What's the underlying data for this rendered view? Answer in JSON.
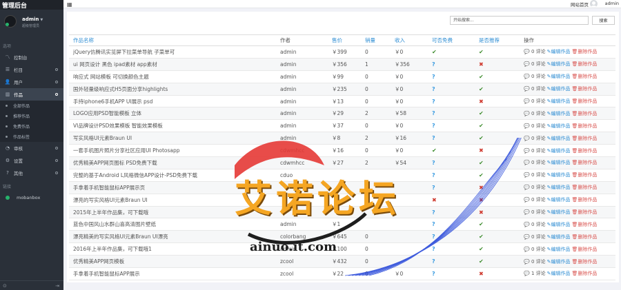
{
  "app": {
    "title": "管理后台"
  },
  "user": {
    "name": "admin",
    "role": "超级管理员"
  },
  "sidebar": {
    "section_title": "选项",
    "items": [
      {
        "label": "控制台",
        "icon": "chart-line-icon"
      },
      {
        "label": "栏目",
        "icon": "list-icon"
      },
      {
        "label": "用户",
        "icon": "user-icon"
      },
      {
        "label": "作品",
        "icon": "book-icon"
      }
    ],
    "sub_items": [
      "全部作品",
      "推荐作品",
      "免费作品",
      "作品标签"
    ],
    "items_after": [
      {
        "label": "审核",
        "icon": "circle-icon"
      },
      {
        "label": "设置",
        "icon": "gear-icon"
      },
      {
        "label": "其他",
        "icon": "help-icon"
      }
    ],
    "links_title": "链接",
    "links": [
      "mobanbox"
    ]
  },
  "topbar": {
    "site_link": "网站首页",
    "username": "admin"
  },
  "search": {
    "placeholder": "开始搜索...",
    "button_label": "搜索"
  },
  "table": {
    "headers": [
      "作品名称",
      "作者",
      "售价",
      "销量",
      "收入",
      "可否免费",
      "是否推荐",
      "操作"
    ],
    "op_labels": {
      "comment_suffix": "评论",
      "edit": "编辑作品",
      "delete": "删除作品"
    },
    "rows": [
      {
        "name": "jQuery仿腾讯实览屏下拉菜单导航 子菜单可",
        "author": "admin",
        "price": "￥399",
        "sales": "0",
        "income": "￥0",
        "free": "yes",
        "recommend": "yes",
        "comments": "0"
      },
      {
        "name": "ui 网页设计 黑色 ipad素材 app素材",
        "author": "admin",
        "price": "￥356",
        "sales": "1",
        "income": "￥356",
        "free": "q",
        "recommend": "no",
        "comments": "0"
      },
      {
        "name": "响应式 网站模板 可切换颜色主题",
        "author": "admin",
        "price": "￥99",
        "sales": "0",
        "income": "￥0",
        "free": "q",
        "recommend": "yes",
        "comments": "0"
      },
      {
        "name": "国外轻量级响应式H5页面分享highlights",
        "author": "admin",
        "price": "￥235",
        "sales": "0",
        "income": "￥0",
        "free": "q",
        "recommend": "yes",
        "comments": "0"
      },
      {
        "name": "手持iphone6手机APP UI展示 psd",
        "author": "admin",
        "price": "￥13",
        "sales": "0",
        "income": "￥0",
        "free": "q",
        "recommend": "no",
        "comments": "0"
      },
      {
        "name": "LOGO应用PSD智能模板 立体",
        "author": "admin",
        "price": "￥29",
        "sales": "2",
        "income": "￥58",
        "free": "q",
        "recommend": "yes",
        "comments": "0"
      },
      {
        "name": "VI品牌设计PSD效果模板 智能效果模板",
        "author": "admin",
        "price": "￥37",
        "sales": "0",
        "income": "￥0",
        "free": "q",
        "recommend": "yes",
        "comments": "0"
      },
      {
        "name": "写实风格UI元素Braun UI",
        "author": "admin",
        "price": "￥8",
        "sales": "2",
        "income": "￥16",
        "free": "q",
        "recommend": "yes",
        "comments": "0"
      },
      {
        "name": "一套手机图片照片分享社区应用UI Photosapp",
        "author": "cdwmhcc",
        "price": "￥16",
        "sales": "0",
        "income": "￥0",
        "free": "yes",
        "recommend": "no",
        "comments": "0"
      },
      {
        "name": "优秀精美APP网页图标 PSD免费下载",
        "author": "cdwmhcc",
        "price": "￥27",
        "sales": "2",
        "income": "￥54",
        "free": "q",
        "recommend": "yes",
        "comments": "0"
      },
      {
        "name": "完整的基于Android L风格微信APP设计-PSD免费下载",
        "author": "cduo",
        "price": "",
        "sales": "",
        "income": "",
        "free": "q",
        "recommend": "yes",
        "comments": "0"
      },
      {
        "name": "手拿着手机智能鼠标APP展示页",
        "author": "",
        "price": "",
        "sales": "",
        "income": "",
        "free": "q",
        "recommend": "no",
        "comments": "0"
      },
      {
        "name": "漂亮的写实风格UI元素Braun UI",
        "author": "",
        "price": "",
        "sales": "",
        "income": "",
        "free": "no",
        "recommend": "no",
        "comments": "0"
      },
      {
        "name": "2015年上半年作品集，可下载哦",
        "author": "",
        "price": "",
        "sales": "",
        "income": "",
        "free": "q",
        "recommend": "no",
        "comments": "0"
      },
      {
        "name": "蓝色中国风山水群山喜高清图片壁纸",
        "author": "admin",
        "price": "￥1",
        "sales": "",
        "income": "",
        "free": "q",
        "recommend": "yes",
        "comments": "0"
      },
      {
        "name": "漂亮精美的写实风格UI元素Braun UI漂亮",
        "author": "colorbang",
        "price": "￥645",
        "sales": "0",
        "income": "",
        "free": "q",
        "recommend": "yes",
        "comments": "0"
      },
      {
        "name": "2016年上半年作品集，可下载哦1",
        "author": "admin",
        "price": "￥100",
        "sales": "0",
        "income": "",
        "free": "q",
        "recommend": "yes",
        "comments": "0"
      },
      {
        "name": "优秀精美APP网页模板",
        "author": "zcool",
        "price": "￥432",
        "sales": "0",
        "income": "",
        "free": "q",
        "recommend": "yes",
        "comments": "0"
      },
      {
        "name": "手拿着手机智能鼠标APP展示",
        "author": "zcool",
        "price": "￥22",
        "sales": "0",
        "income": "￥0",
        "free": "q",
        "recommend": "no",
        "comments": "1"
      }
    ]
  },
  "watermark": {
    "text": "艾诺论坛",
    "url": "ainuo.it.com"
  }
}
